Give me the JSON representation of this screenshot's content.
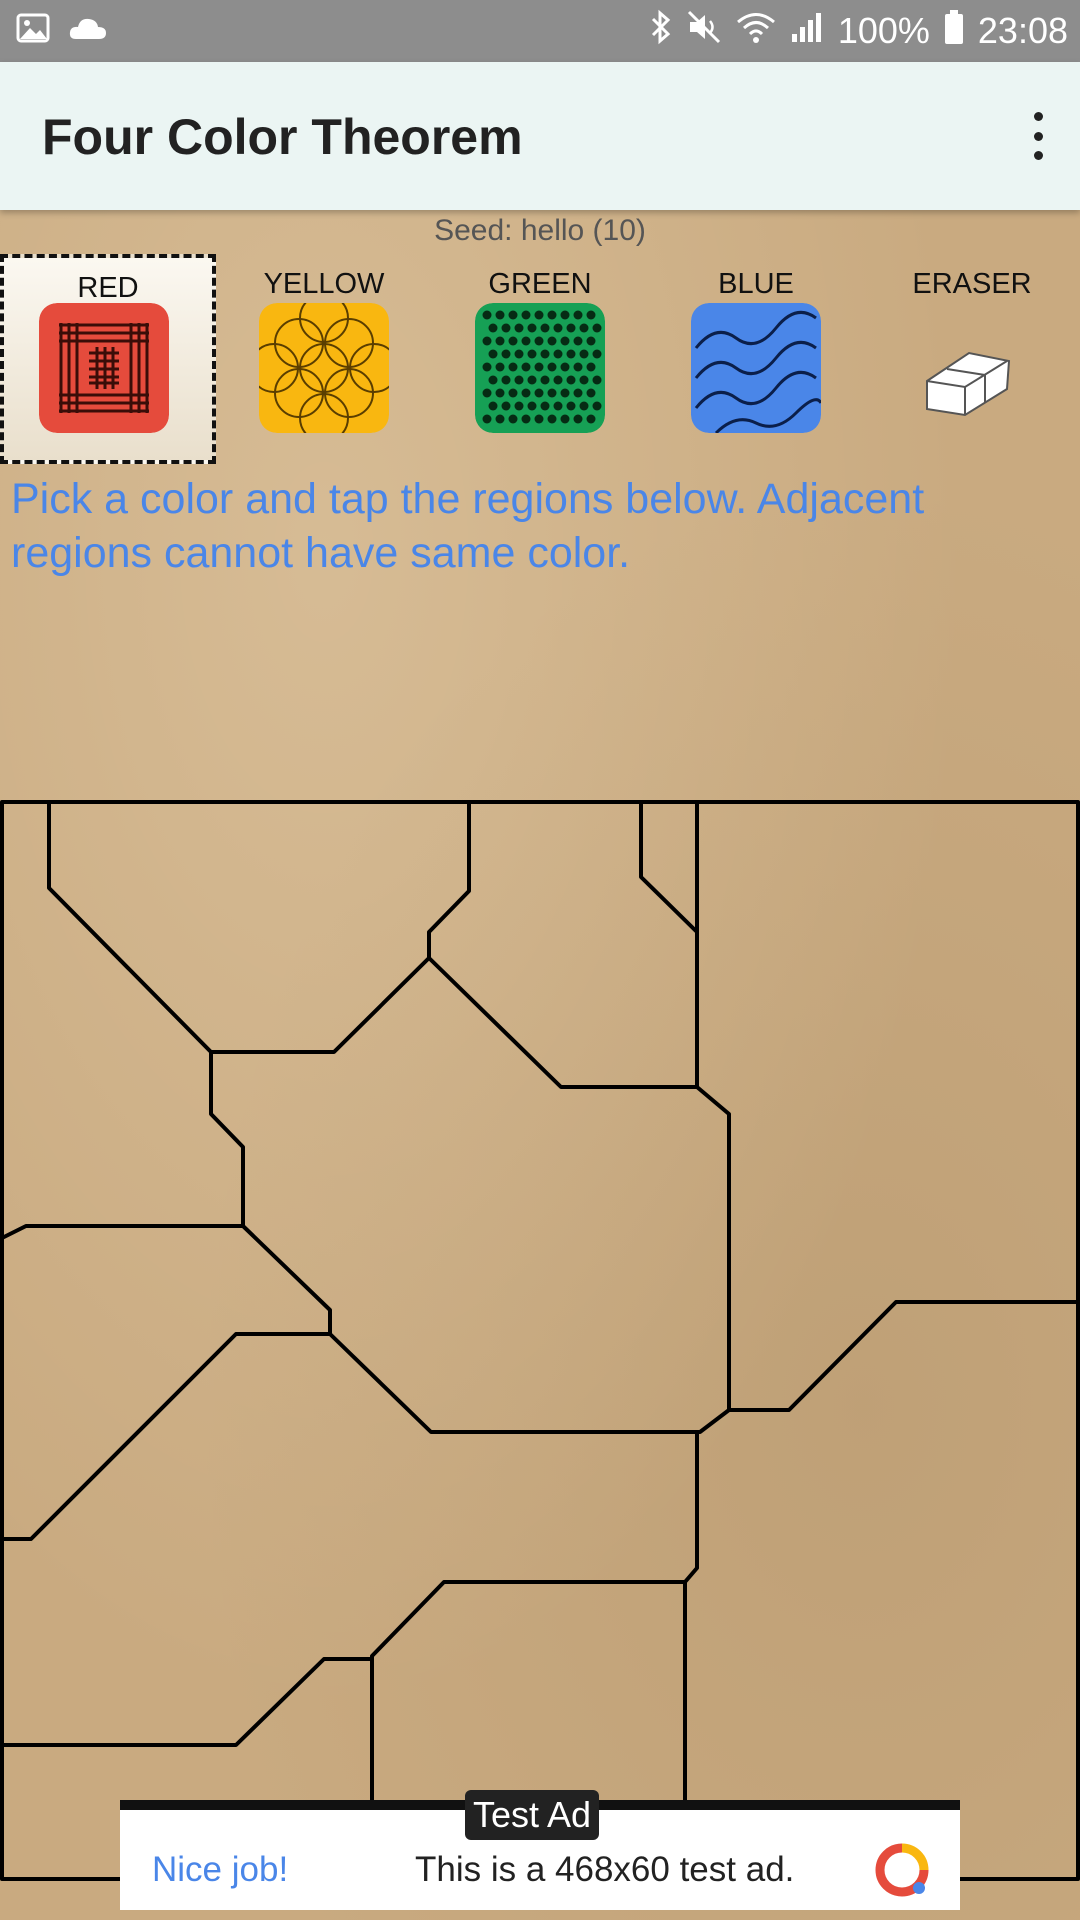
{
  "status_bar": {
    "battery_percent": "100%",
    "time": "23:08",
    "icons": [
      "gallery-icon",
      "cloud-icon",
      "bluetooth-icon",
      "mute-icon",
      "wifi-icon",
      "signal-icon",
      "battery-icon"
    ]
  },
  "app_bar": {
    "title": "Four Color Theorem",
    "menu_icon": "more-vert-icon"
  },
  "seed_text": "Seed: hello (10)",
  "palette": {
    "selected": "RED",
    "items": [
      {
        "label": "RED",
        "color": "#e54b3c",
        "pattern": "weave"
      },
      {
        "label": "YELLOW",
        "color": "#f9b710",
        "pattern": "rings"
      },
      {
        "label": "GREEN",
        "color": "#16a055",
        "pattern": "dots"
      },
      {
        "label": "BLUE",
        "color": "#4a86e8",
        "pattern": "waves"
      },
      {
        "label": "ERASER",
        "color": "#ffffff",
        "pattern": "eraser-icon"
      }
    ]
  },
  "instructions": "Pick a color and tap the regions below. Adjacent regions cannot have same color.",
  "map": {
    "region_count": 10,
    "border_color": "#000000"
  },
  "ad": {
    "badge": "Test Ad",
    "headline": "Nice job!",
    "body": "This is a 468x60 test ad."
  }
}
